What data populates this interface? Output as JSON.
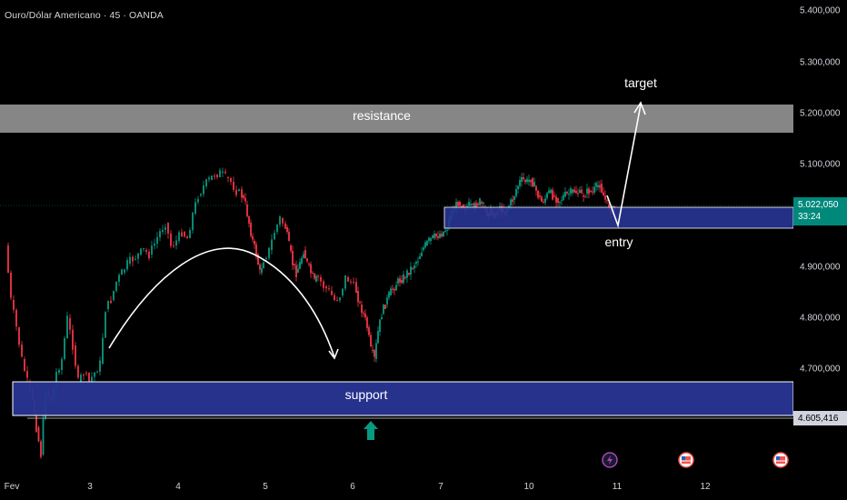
{
  "header": {
    "symbol": "Ouro/Dólar Americano · 45 · OANDA"
  },
  "price_axis": {
    "ticks": [
      "5.400,000",
      "5.300,000",
      "5.200,000",
      "5.100,000",
      "4.900,000",
      "4.800,000",
      "4.700,000"
    ],
    "current_price": {
      "value": "5.022,050",
      "countdown": "33:24",
      "color": "#00897b"
    },
    "support_price": {
      "value": "4.605,416",
      "bg": "#d1d4dc",
      "fg": "#000000"
    }
  },
  "time_axis": {
    "labels": [
      "Fev",
      "3",
      "4",
      "5",
      "6",
      "7",
      "10",
      "11",
      "12"
    ]
  },
  "annotations": {
    "resistance": "resistance",
    "support": "support",
    "entry": "entry",
    "target": "target"
  },
  "colors": {
    "bull": "#089981",
    "bear": "#f23645",
    "zone_blue": "#283593",
    "zone_gray": "#9e9e9e",
    "event_flash": "#ab47bc",
    "event_flag": "#ef5350"
  },
  "event_icons": [
    "flash-icon",
    "us-flag-icon",
    "us-flag-icon"
  ]
}
